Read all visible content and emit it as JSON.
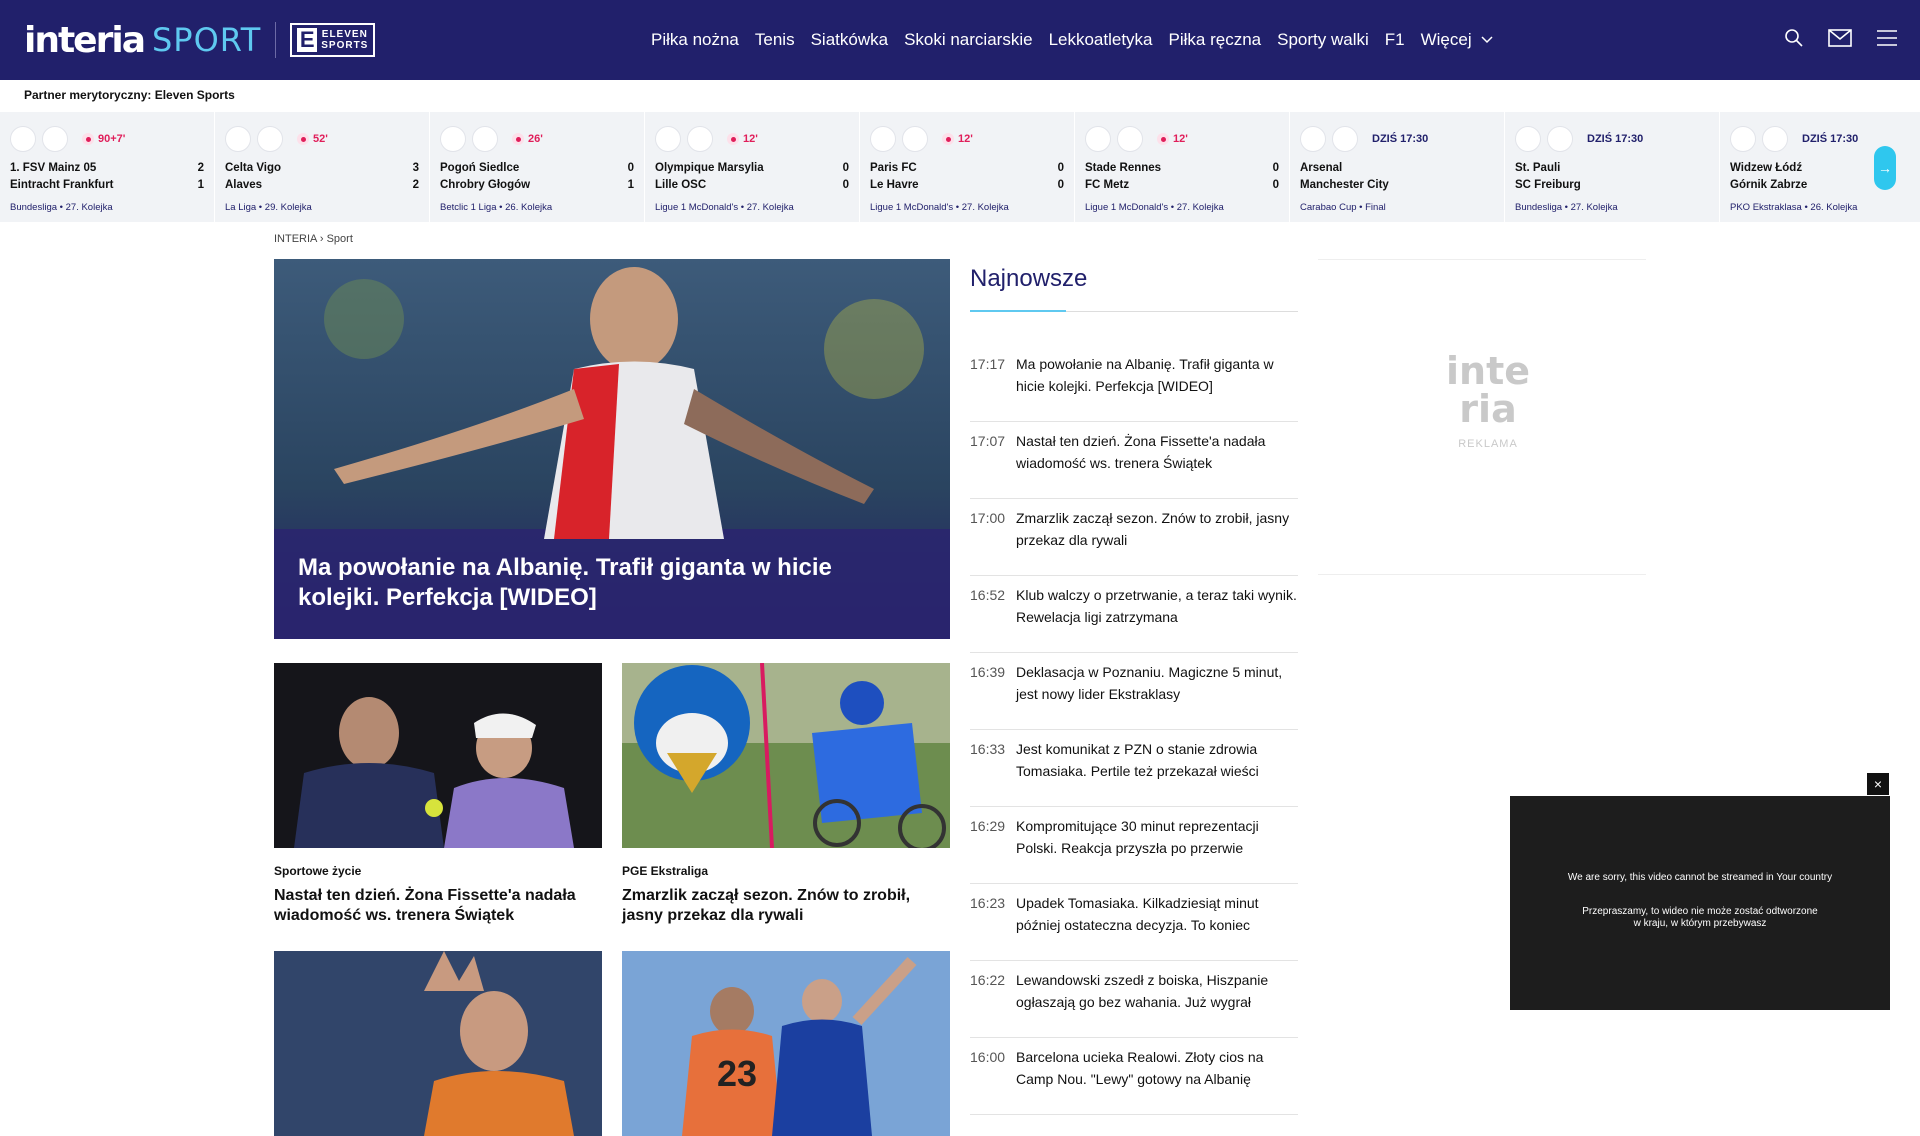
{
  "brand": {
    "interia": "interia",
    "sport": "SPORT",
    "eleven_line1": "ELEVEN",
    "eleven_line2": "SPORTS"
  },
  "nav": {
    "items": [
      "Piłka nożna",
      "Tenis",
      "Siatkówka",
      "Skoki narciarskie",
      "Lekkoatletyka",
      "Piłka ręczna",
      "Sporty walki",
      "F1"
    ],
    "more": "Więcej"
  },
  "partner": "Partner merytoryczny: Eleven Sports",
  "matches": [
    {
      "status": "90+7'",
      "live": true,
      "home": "1. FSV Mainz 05",
      "away": "Eintracht Frankfurt",
      "hs": "2",
      "as": "1",
      "league": "Bundesliga",
      "round": "27. Kolejka"
    },
    {
      "status": "52'",
      "live": true,
      "home": "Celta Vigo",
      "away": "Alaves",
      "hs": "3",
      "as": "2",
      "league": "La Liga",
      "round": "29. Kolejka"
    },
    {
      "status": "26'",
      "live": true,
      "home": "Pogoń Siedlce",
      "away": "Chrobry Głogów",
      "hs": "0",
      "as": "1",
      "league": "Betclic 1 Liga",
      "round": "26. Kolejka"
    },
    {
      "status": "12'",
      "live": true,
      "home": "Olympique Marsylia",
      "away": "Lille OSC",
      "hs": "0",
      "as": "0",
      "league": "Ligue 1 McDonald's",
      "round": "27. Kolejka"
    },
    {
      "status": "12'",
      "live": true,
      "home": "Paris FC",
      "away": "Le Havre",
      "hs": "0",
      "as": "0",
      "league": "Ligue 1 McDonald's",
      "round": "27. Kolejka"
    },
    {
      "status": "12'",
      "live": true,
      "home": "Stade Rennes",
      "away": "FC Metz",
      "hs": "0",
      "as": "0",
      "league": "Ligue 1 McDonald's",
      "round": "27. Kolejka"
    },
    {
      "status": "DZIŚ 17:30",
      "live": false,
      "home": "Arsenal",
      "away": "Manchester City",
      "hs": "",
      "as": "",
      "league": "Carabao Cup",
      "round": "Final"
    },
    {
      "status": "DZIŚ 17:30",
      "live": false,
      "home": "St. Pauli",
      "away": "SC Freiburg",
      "hs": "",
      "as": "",
      "league": "Bundesliga",
      "round": "27. Kolejka"
    },
    {
      "status": "DZIŚ 17:30",
      "live": false,
      "home": "Widzew Łódź",
      "away": "Górnik Zabrze",
      "hs": "",
      "as": "",
      "league": "PKO Ekstraklasa",
      "round": "26. Kolejka"
    }
  ],
  "breadcrumb": [
    "INTERIA",
    "Sport"
  ],
  "hero": {
    "title": "Ma powołanie na Albanię. Trafił giganta w hicie kolejki. Perfekcja [WIDEO]"
  },
  "tiles": [
    {
      "category": "Sportowe życie",
      "title": "Nastał ten dzień. Żona Fissette'a nadała wiadomość ws. trenera Świątek"
    },
    {
      "category": "PGE Ekstraliga",
      "title": "Zmarzlik zaczął sezon. Znów to zrobił, jasny przekaz dla rywali"
    }
  ],
  "latest": {
    "heading": "Najnowsze",
    "items": [
      {
        "time": "17:17",
        "title": "Ma powołanie na Albanię. Trafił giganta w hicie kolejki. Perfekcja [WIDEO]"
      },
      {
        "time": "17:07",
        "title": "Nastał ten dzień. Żona Fissette'a nadała wiadomość ws. trenera Świątek"
      },
      {
        "time": "17:00",
        "title": "Zmarzlik zaczął sezon. Znów to zrobił, jasny przekaz dla rywali"
      },
      {
        "time": "16:52",
        "title": "Klub walczy o przetrwanie, a teraz taki wynik. Rewelacja ligi zatrzymana"
      },
      {
        "time": "16:39",
        "title": "Deklasacja w Poznaniu. Magiczne 5 minut, jest nowy lider Ekstraklasy"
      },
      {
        "time": "16:33",
        "title": "Jest komunikat z PZN o stanie zdrowia Tomasiaka. Pertile też przekazał wieści"
      },
      {
        "time": "16:29",
        "title": "Kompromitujące 30 minut reprezentacji Polski. Reakcja przyszła po przerwie"
      },
      {
        "time": "16:23",
        "title": "Upadek Tomasiaka. Kilkadziesiąt minut później ostateczna decyzja. To koniec"
      },
      {
        "time": "16:22",
        "title": "Lewandowski zszedł z boiska, Hiszpanie ogłaszają go bez wahania. Już wygrał"
      },
      {
        "time": "16:00",
        "title": "Barcelona ucieka Realowi. Złoty cios na Camp Nou. \"Lewy\" gotowy na Albanię"
      }
    ]
  },
  "ad": {
    "logo1": "inte",
    "logo2": "ria",
    "label": "REKLAMA"
  },
  "video": {
    "msg_en": "We are sorry, this video cannot be streamed in Your country",
    "msg_pl": "Przepraszamy, to wideo nie może zostać odtworzone w kraju, w którym przebywasz",
    "close": "×"
  },
  "colors": {
    "navy": "#21206b",
    "accent": "#5fc9f0",
    "live": "#e01e5a"
  }
}
